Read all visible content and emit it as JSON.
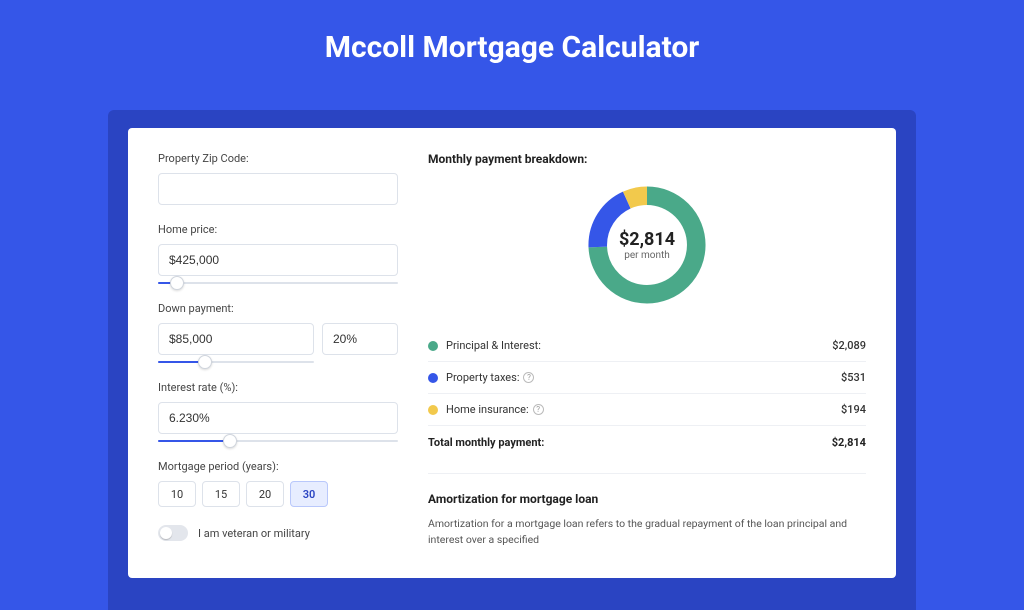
{
  "title": "Mccoll Mortgage Calculator",
  "form": {
    "zip_label": "Property Zip Code:",
    "zip_value": "",
    "home_price_label": "Home price:",
    "home_price_value": "$425,000",
    "home_price_slider_pct": 8,
    "down_payment_label": "Down payment:",
    "down_payment_amount": "$85,000",
    "down_payment_pct": "20%",
    "down_payment_slider_pct": 20,
    "interest_label": "Interest rate (%):",
    "interest_value": "6.230%",
    "interest_slider_pct": 30,
    "period_label": "Mortgage period (years):",
    "periods": [
      "10",
      "15",
      "20",
      "30"
    ],
    "period_selected": "30",
    "veteran_label": "I am veteran or military",
    "veteran_on": false
  },
  "breakdown": {
    "title": "Monthly payment breakdown:",
    "center_amount": "$2,814",
    "center_sub": "per month",
    "items": [
      {
        "label": "Principal & Interest:",
        "value": "$2,089",
        "color": "#4aa989",
        "help": false
      },
      {
        "label": "Property taxes:",
        "value": "$531",
        "color": "#3556e8",
        "help": true
      },
      {
        "label": "Home insurance:",
        "value": "$194",
        "color": "#f2c94c",
        "help": true
      }
    ],
    "total_label": "Total monthly payment:",
    "total_value": "$2,814"
  },
  "amortization": {
    "title": "Amortization for mortgage loan",
    "text": "Amortization for a mortgage loan refers to the gradual repayment of the loan principal and interest over a specified"
  },
  "chart_data": {
    "type": "pie",
    "title": "Monthly payment breakdown",
    "series": [
      {
        "name": "Principal & Interest",
        "value": 2089,
        "color": "#4aa989"
      },
      {
        "name": "Property taxes",
        "value": 531,
        "color": "#3556e8"
      },
      {
        "name": "Home insurance",
        "value": 194,
        "color": "#f2c94c"
      }
    ],
    "total": 2814,
    "center_label": "$2,814 per month"
  }
}
